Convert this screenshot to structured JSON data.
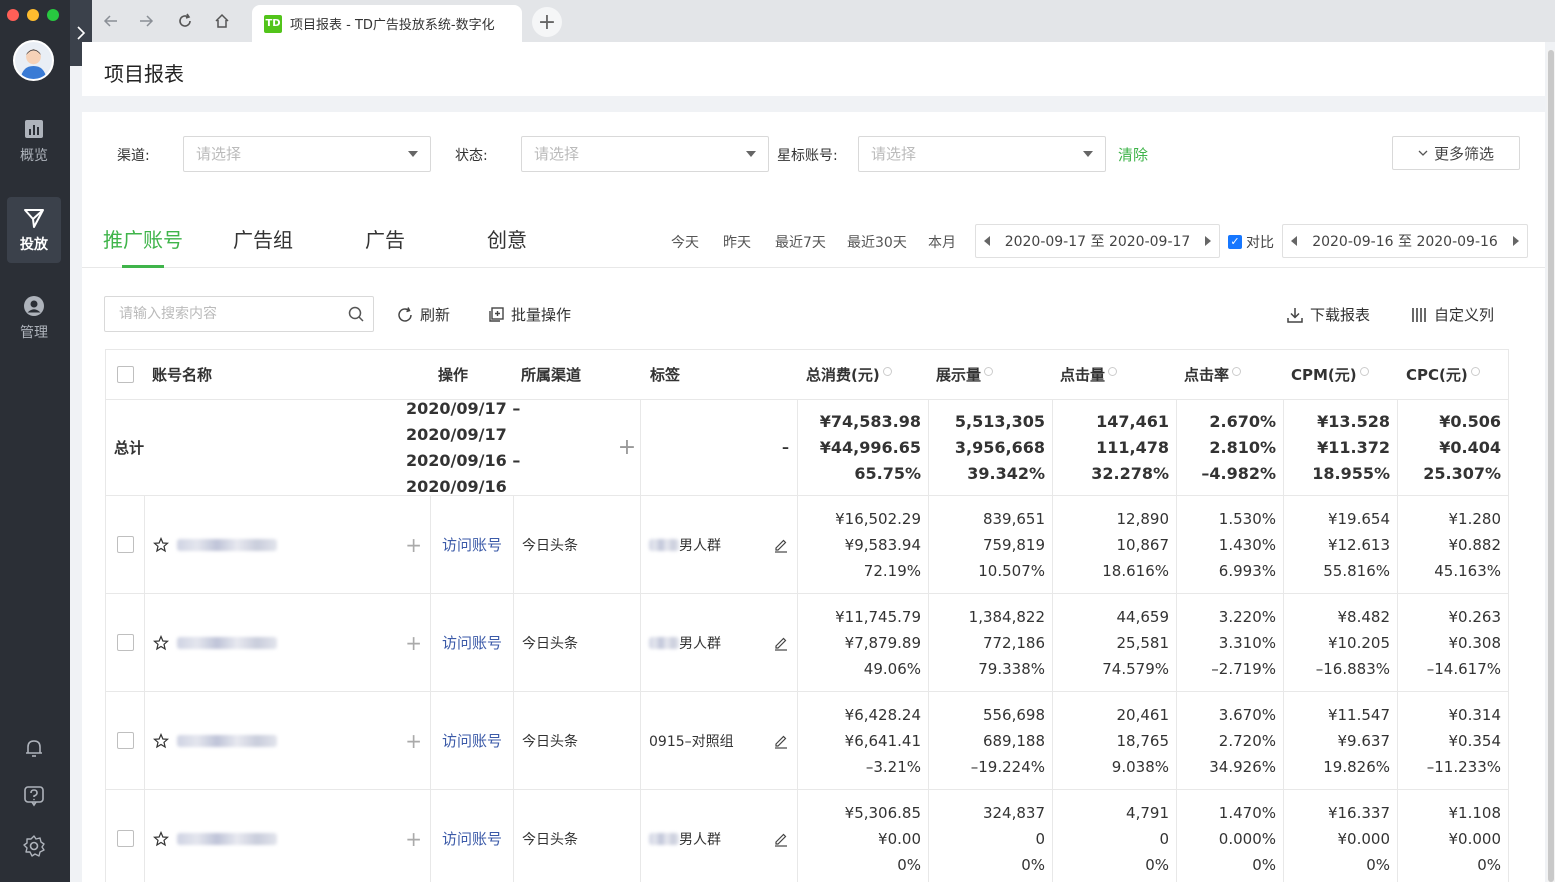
{
  "browser": {
    "tab_title": "项目报表 - TD广告投放系统-数字化",
    "tab_logo": "TD"
  },
  "sidebar": {
    "items": [
      {
        "label": "概览",
        "icon": "chart-icon"
      },
      {
        "label": "投放",
        "icon": "send-icon",
        "active": true
      },
      {
        "label": "管理",
        "icon": "user-icon"
      }
    ]
  },
  "page": {
    "title": "项目报表"
  },
  "filters": {
    "channel_label": "渠道:",
    "status_label": "状态:",
    "star_label": "星标账号:",
    "placeholder": "请选择",
    "clear": "清除",
    "more": "更多筛选"
  },
  "tabs": [
    "推广账号",
    "广告组",
    "广告",
    "创意"
  ],
  "quick_ranges": [
    "今天",
    "昨天",
    "最近7天",
    "最近30天",
    "本月"
  ],
  "date_range": "2020-09-17 至 2020-09-17",
  "compare_label": "对比",
  "compare_range": "2020-09-16 至 2020-09-16",
  "toolbar": {
    "search_placeholder": "请输入搜索内容",
    "refresh": "刷新",
    "batch": "批量操作",
    "download": "下载报表",
    "custom_cols": "自定义列"
  },
  "table": {
    "headers": {
      "name": "账号名称",
      "ops": "操作",
      "channel": "所属渠道",
      "tag": "标签",
      "cost": "总消费(元)",
      "impr": "展示量",
      "clicks": "点击量",
      "ctr": "点击率",
      "cpm": "CPM(元)",
      "cpc": "CPC(元)"
    },
    "total": {
      "label": "总计",
      "range1": "2020/09/17 – 2020/09/17",
      "range2": "2020/09/16 – 2020/09/16",
      "tag": "–",
      "cost": [
        "¥74,583.98",
        "¥44,996.65",
        "65.75%"
      ],
      "impr": [
        "5,513,305",
        "3,956,668",
        "39.342%"
      ],
      "clicks": [
        "147,461",
        "111,478",
        "32.278%"
      ],
      "ctr": [
        "2.670%",
        "2.810%",
        "–4.982%"
      ],
      "cpm": [
        "¥13.528",
        "¥11.372",
        "18.955%"
      ],
      "cpc": [
        "¥0.506",
        "¥0.404",
        "25.307%"
      ]
    },
    "rows": [
      {
        "link": "访问账号",
        "channel": "今日头条",
        "tag": "男人群",
        "cost": [
          "¥16,502.29",
          "¥9,583.94",
          "72.19%"
        ],
        "impr": [
          "839,651",
          "759,819",
          "10.507%"
        ],
        "clicks": [
          "12,890",
          "10,867",
          "18.616%"
        ],
        "ctr": [
          "1.530%",
          "1.430%",
          "6.993%"
        ],
        "cpm": [
          "¥19.654",
          "¥12.613",
          "55.816%"
        ],
        "cpc": [
          "¥1.280",
          "¥0.882",
          "45.163%"
        ]
      },
      {
        "link": "访问账号",
        "channel": "今日头条",
        "tag": "男人群",
        "cost": [
          "¥11,745.79",
          "¥7,879.89",
          "49.06%"
        ],
        "impr": [
          "1,384,822",
          "772,186",
          "79.338%"
        ],
        "clicks": [
          "44,659",
          "25,581",
          "74.579%"
        ],
        "ctr": [
          "3.220%",
          "3.310%",
          "–2.719%"
        ],
        "cpm": [
          "¥8.482",
          "¥10.205",
          "–16.883%"
        ],
        "cpc": [
          "¥0.263",
          "¥0.308",
          "–14.617%"
        ]
      },
      {
        "link": "访问账号",
        "channel": "今日头条",
        "tag": "0915–对照组",
        "cost": [
          "¥6,428.24",
          "¥6,641.41",
          "–3.21%"
        ],
        "impr": [
          "556,698",
          "689,188",
          "–19.224%"
        ],
        "clicks": [
          "20,461",
          "18,765",
          "9.038%"
        ],
        "ctr": [
          "3.670%",
          "2.720%",
          "34.926%"
        ],
        "cpm": [
          "¥11.547",
          "¥9.637",
          "19.826%"
        ],
        "cpc": [
          "¥0.314",
          "¥0.354",
          "–11.233%"
        ]
      },
      {
        "link": "访问账号",
        "channel": "今日头条",
        "tag": "男人群",
        "cost": [
          "¥5,306.85",
          "¥0.00",
          "0%"
        ],
        "impr": [
          "324,837",
          "0",
          "0%"
        ],
        "clicks": [
          "4,791",
          "0",
          "0%"
        ],
        "ctr": [
          "1.470%",
          "0.000%",
          "0%"
        ],
        "cpm": [
          "¥16.337",
          "¥0.000",
          "0%"
        ],
        "cpc": [
          "¥1.108",
          "¥0.000",
          "0%"
        ]
      }
    ]
  }
}
